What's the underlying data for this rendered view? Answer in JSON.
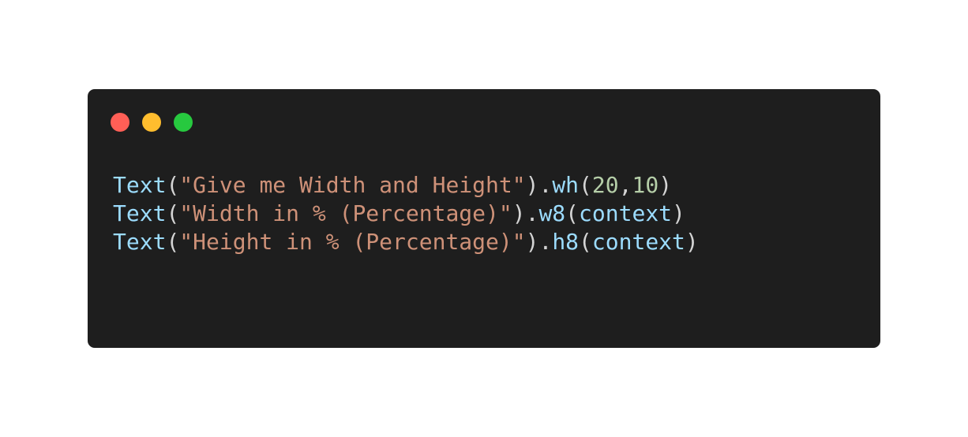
{
  "window": {
    "controls": [
      {
        "name": "close",
        "color": "#ff5f56"
      },
      {
        "name": "minimize",
        "color": "#ffbd2e"
      },
      {
        "name": "maximize",
        "color": "#27c93f"
      }
    ]
  },
  "theme": {
    "background": "#1e1e1e",
    "identifier": "#9cdcfe",
    "string": "#ce9178",
    "number": "#b5cea8",
    "punctuation": "#d4d4d4"
  },
  "code": {
    "lines": [
      [
        {
          "text": "Text",
          "kind": "identifier"
        },
        {
          "text": "(",
          "kind": "punctuation"
        },
        {
          "text": "\"Give me Width and Height\"",
          "kind": "string"
        },
        {
          "text": ").",
          "kind": "punctuation"
        },
        {
          "text": "wh",
          "kind": "identifier"
        },
        {
          "text": "(",
          "kind": "punctuation"
        },
        {
          "text": "20",
          "kind": "number"
        },
        {
          "text": ",",
          "kind": "punctuation"
        },
        {
          "text": "10",
          "kind": "number"
        },
        {
          "text": ")",
          "kind": "punctuation"
        }
      ],
      [
        {
          "text": "Text",
          "kind": "identifier"
        },
        {
          "text": "(",
          "kind": "punctuation"
        },
        {
          "text": "\"Width in % (Percentage)\"",
          "kind": "string"
        },
        {
          "text": ").",
          "kind": "punctuation"
        },
        {
          "text": "w8",
          "kind": "identifier"
        },
        {
          "text": "(",
          "kind": "punctuation"
        },
        {
          "text": "context",
          "kind": "identifier"
        },
        {
          "text": ")",
          "kind": "punctuation"
        }
      ],
      [
        {
          "text": "Text",
          "kind": "identifier"
        },
        {
          "text": "(",
          "kind": "punctuation"
        },
        {
          "text": "\"Height in % (Percentage)\"",
          "kind": "string"
        },
        {
          "text": ").",
          "kind": "punctuation"
        },
        {
          "text": "h8",
          "kind": "identifier"
        },
        {
          "text": "(",
          "kind": "punctuation"
        },
        {
          "text": "context",
          "kind": "identifier"
        },
        {
          "text": ")",
          "kind": "punctuation"
        }
      ]
    ]
  }
}
